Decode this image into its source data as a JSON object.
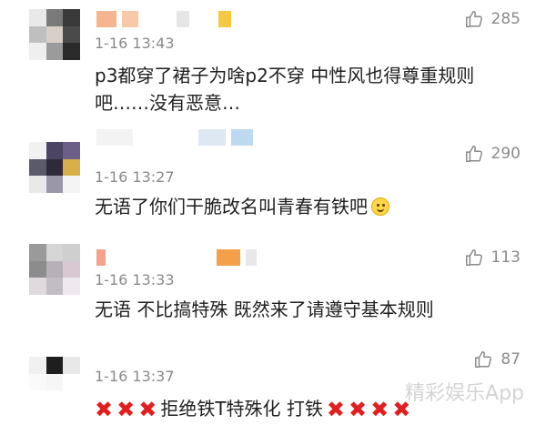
{
  "comments": [
    {
      "time": "1-16 13:43",
      "text": "p3都穿了裙子为啥p2不穿 中性风也得尊重规则吧……没有恶意…",
      "likes": "285"
    },
    {
      "time": "1-16 13:27",
      "text": "无语了你们干脆改名叫青春有铁吧",
      "emoji": "smile-emoji",
      "likes": "290"
    },
    {
      "time": "1-16 13:33",
      "text": "无语 不比搞特殊 既然来了请遵守基本规则",
      "likes": "113"
    },
    {
      "time": "1-16 13:37",
      "text_middle": "拒绝铁T特殊化  打铁",
      "xmarks_before": "✖✖✖",
      "xmarks_after": "✖✖✖✖",
      "likes": "87"
    }
  ],
  "watermark": "精彩娱乐App",
  "icons": {
    "like": "thumbs-up-icon",
    "avatar": "blurred-avatar",
    "emoji": "smile-emoji",
    "xmark": "red-cross-mark"
  },
  "colors": {
    "meta_text": "#8a8a8a",
    "body_text": "#1f1f1f",
    "xmark": "#e02020"
  }
}
